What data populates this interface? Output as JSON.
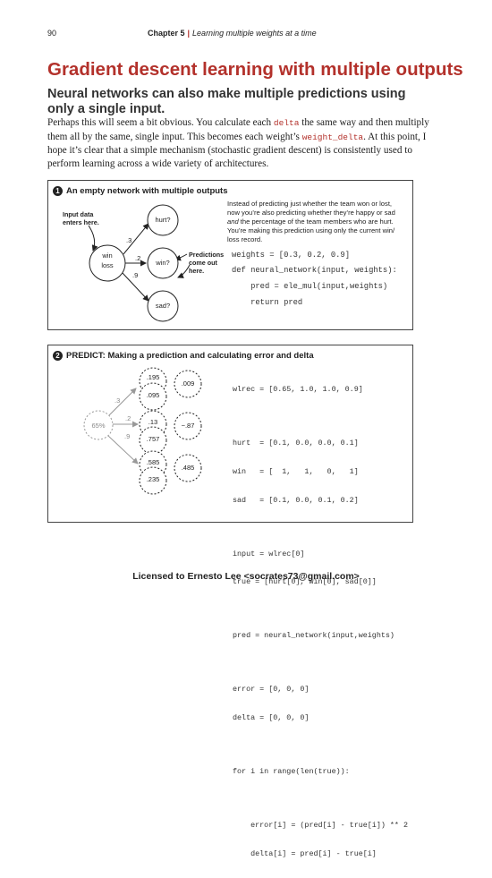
{
  "header": {
    "page_number": "90",
    "chapter": "Chapter 5",
    "chapter_title": "Learning multiple weights at a time"
  },
  "title": "Gradient descent learning with multiple outputs",
  "subtitle": "Neural networks can also make multiple predictions using only a single input.",
  "intro": {
    "p1": "Perhaps this will seem a bit obvious. You calculate each ",
    "code1": "delta",
    "p2": " the same way and then multiply them all by the same, single input. This becomes each weight’s ",
    "code2": "weight_delta",
    "p3": ". At this point, I hope it’s clear that a simple mechanism (stochastic gradient descent) is consistently used to perform learning across a wide variety of architectures."
  },
  "box1": {
    "number": "1",
    "title": "An empty network with multiple outputs",
    "note_input_1": "Input data",
    "note_input_2": "enters here.",
    "note_pred_1": "Predictions",
    "note_pred_2": "come out",
    "note_pred_3": "here.",
    "input_node_1": "win",
    "input_node_2": "loss",
    "outputs": [
      "hurt?",
      "win?",
      "sad?"
    ],
    "weights": [
      ".3",
      ".2",
      ".9"
    ],
    "desc_1": "Instead of predicting just whether the team won or lost,",
    "desc_2a": "now you’re also predicting whether they’re happy or sad",
    "desc_3a": "and",
    "desc_3b": " the percentage of the team members who are hurt.",
    "desc_4": "You’re making this prediction using only the current win/",
    "desc_5": "loss record.",
    "code_1": "weights = [0.3, 0.2, 0.9]",
    "code_2": "def neural_network(input, weights):",
    "code_3": "    pred = ele_mul(input,weights)",
    "code_4": "    return pred"
  },
  "box2": {
    "number": "2",
    "title": "PREDICT: Making a prediction and calculating error and delta",
    "input_value": "65%",
    "weights": [
      ".3",
      ".2",
      ".9"
    ],
    "pred_values": [
      ".195",
      ".13",
      ".585"
    ],
    "true_values": [
      ".095",
      ".757",
      ".235"
    ],
    "deltas": [
      ".009",
      "−.87",
      ".485"
    ],
    "code": [
      "wlrec = [0.65, 1.0, 1.0, 0.9]",
      "",
      "hurt  = [0.1, 0.0, 0.0, 0.1]",
      "win   = [  1,   1,   0,   1]",
      "sad   = [0.1, 0.0, 0.1, 0.2]",
      "",
      "input = wlrec[0]",
      "true = [hurt[0], win[0], sad[0]]",
      "",
      "pred = neural_network(input,weights)",
      "",
      "error = [0, 0, 0]",
      "delta = [0, 0, 0]",
      "",
      "for i in range(len(true)):",
      "",
      "    error[i] = (pred[i] - true[i]) ** 2",
      "    delta[i] = pred[i] - true[i]"
    ]
  },
  "footer": "Licensed to Ernesto Lee <socrates73@gmail.com>"
}
